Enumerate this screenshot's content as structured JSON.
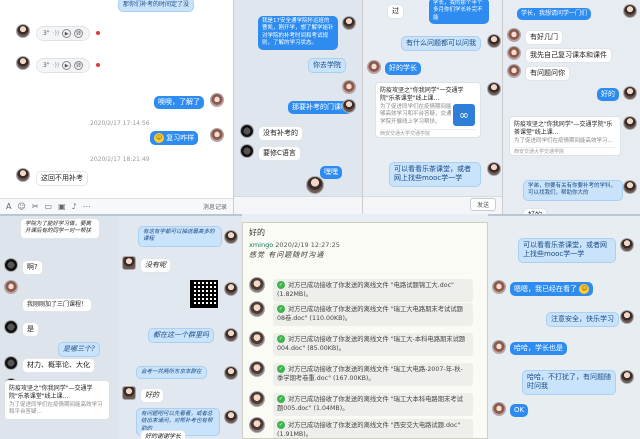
{
  "p1": {
    "top_text": "那你们补考的时间定了没",
    "voice1": {
      "dur": "3\"",
      "wave": "·))",
      "trans": "转"
    },
    "voice2": {
      "dur": "3\"",
      "wave": "·))",
      "trans": "转"
    },
    "msg_ok": "噢噢，了解了",
    "ts1": "2020/2/17 17:14:56",
    "msg_thanks": "复习咋样",
    "ts2": "2020/2/17 18:21:49",
    "msg_nomakeup": "这回不用补考",
    "toolbar": {
      "a": "A",
      "history": "消息记录"
    }
  },
  "p2": {
    "msg_long": "我是17安全通学院怀远班的曹凯，刚开学，想了解学姐针对学院的补考时间和考试规则，了解的学习状态。",
    "msg_q": "你去学院",
    "msg_ans": "那要补考的门课啊",
    "msg_none": "没有补考的",
    "msg_lang": "要修C语言",
    "msg_bye": "嘿嘿"
  },
  "p3": {
    "top_left": "过",
    "top_right": "学长，我的那个半个多月你们学长补完不能",
    "msg_ask": "有什么问题都可以问我",
    "msg_ok": "好的学长",
    "card_title": "防疫攻坚之\"你我同学\"一交通学院\"乐茶课堂\"线上课...",
    "card_desc": "为了促进同学们在疫情期间能够高效学习和平台答疑，交通学院开展线上学习帮扶。",
    "card_src": "西安交通大学交通学院",
    "msg_mooc": "可以看看乐茶课堂，或者网上找些mooc学一学",
    "send": "发送"
  },
  "p4": {
    "msg_top": "学长，我想请问学一门们",
    "msg_which": "有好几门",
    "msg_self": "我先自己复习课本和课件",
    "msg_q": "有问题问你",
    "msg_good": "好的",
    "card_title": "防疫攻坚之\"你我同学\"—交通学院\"乐茶课堂\"线上课...",
    "card_desc": "为了促进同学们在疫情期间能高效学习...",
    "card_src": "西安交通大学交通学院",
    "msg_learn": "学弟，你要有关有你要补考的学科，可以找我们，帮助你大的",
    "msg_good2": "好的"
  },
  "p5": {
    "msg_top": "学院为了能好学习做，要离开课后有的同学一对一帮扶",
    "msg_ah": "啊?",
    "msg_join": "我刚刚加了三门课程！",
    "msg_yes": "是",
    "msg_which": "是哪三个?",
    "msg_subjects": "材力、概率论、大化",
    "card_title": "防疫攻坚之\"你我同学\"—交通学院\"乐茶课堂\"线上课...",
    "card_desc": "为了促进同学们在疫情期间能高效学习和平台答疑..."
  },
  "p6": {
    "msg_top": "有这有学都可以抽进最高多的课程",
    "msg_nope": "没有呢",
    "msg_lecture": "都在这一个群里吗",
    "msg_group": "会考一共两所东京本群在",
    "msg_ok": "好的",
    "msg_long": "有问题吧可以先看看，或者总结出来请问，对帮补考也有帮助的",
    "msg_last": "好的谢谢学长"
  },
  "p7": {
    "top": "好的",
    "sender": "xmingo",
    "ts": "2020/2/19 12:27:25",
    "text": "感觉 有问题随时沟通",
    "msgs": [
      "对方已成功接收了你发送的离线文件 \"电路试题锦工大.doc\" (1.82MB)。",
      "对方已成功接收了你发送的离线文件 \"瑞工大电路期末考试试题08卷.doc\" (110.00KB)。",
      "对方已成功接收了你发送的离线文件 \"瑞工大-本科电路期末试题004.doc\" (85.00KB)。",
      "对方已成功接收了你发送的离线文件 \"瑞工大电路-2007-年-秋-季学期考卷重.doc\" (167.00KB)。",
      "对方已成功接收了你发送的离线文件 \"瑞工大本科电路期末考试题005.doc\" (1.04MB)。",
      "对方已成功接收了你发送的离线文件 \"西安交大电路试题.doc\" (1.91MB)。"
    ]
  },
  "p8": {
    "msg_mooc": "可以看看乐茶课堂，或者网上找些mooc学一学",
    "msg_thanks": "嗯嗯，我已经在看了",
    "msg_safe": "注意安全，快乐学习",
    "msg_haha": "哈哈，学长也是",
    "msg_help": "哈哈，不打扰了，有问题随时问我",
    "msg_ok": "OK"
  },
  "colors": {
    "accent": "#2e8cf0",
    "success": "#3fb34f"
  }
}
